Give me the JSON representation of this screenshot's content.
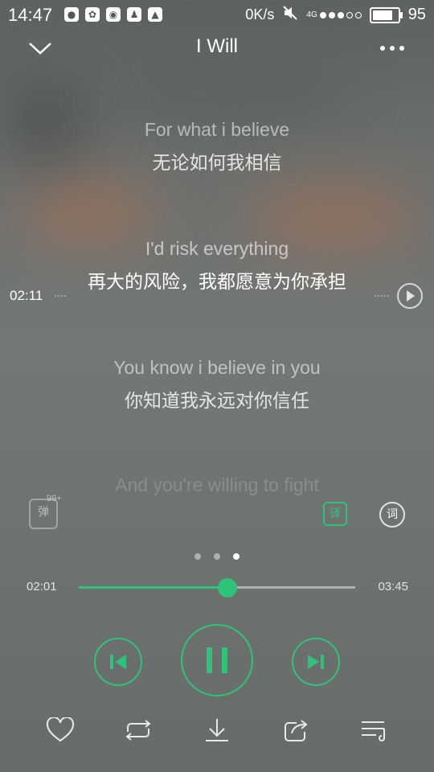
{
  "status_bar": {
    "time": "14:47",
    "net_speed": "0K/s",
    "network": "4G",
    "battery": "95",
    "battery_level": 0.95
  },
  "header": {
    "title": "I Will"
  },
  "lyrics": [
    {
      "en": "For what i believe",
      "zh": "无论如何我相信"
    },
    {
      "en": "I'd risk everything",
      "zh": "再大的风险，我都愿意为你承担"
    },
    {
      "en": "You know i believe in you",
      "zh": "你知道我永远对你信任"
    },
    {
      "en": "And you're willing to fight",
      "zh": ""
    }
  ],
  "seek_preview": {
    "time": "02:11"
  },
  "tools": {
    "danmu_label": "弹",
    "danmu_count": "99+",
    "translate_label": "译",
    "lyrics_label": "词"
  },
  "pager": {
    "pages": 3,
    "active": 2
  },
  "progress": {
    "current": "02:01",
    "total": "03:45",
    "fraction": 0.537
  },
  "colors": {
    "accent": "#2fc37a"
  },
  "icons": {
    "header_left": "chevron-down-icon",
    "header_right": "more-icon",
    "controls": [
      "previous-icon",
      "pause-icon",
      "next-icon"
    ],
    "bottom": [
      "heart-icon",
      "repeat-icon",
      "download-icon",
      "share-icon",
      "playlist-icon"
    ]
  }
}
